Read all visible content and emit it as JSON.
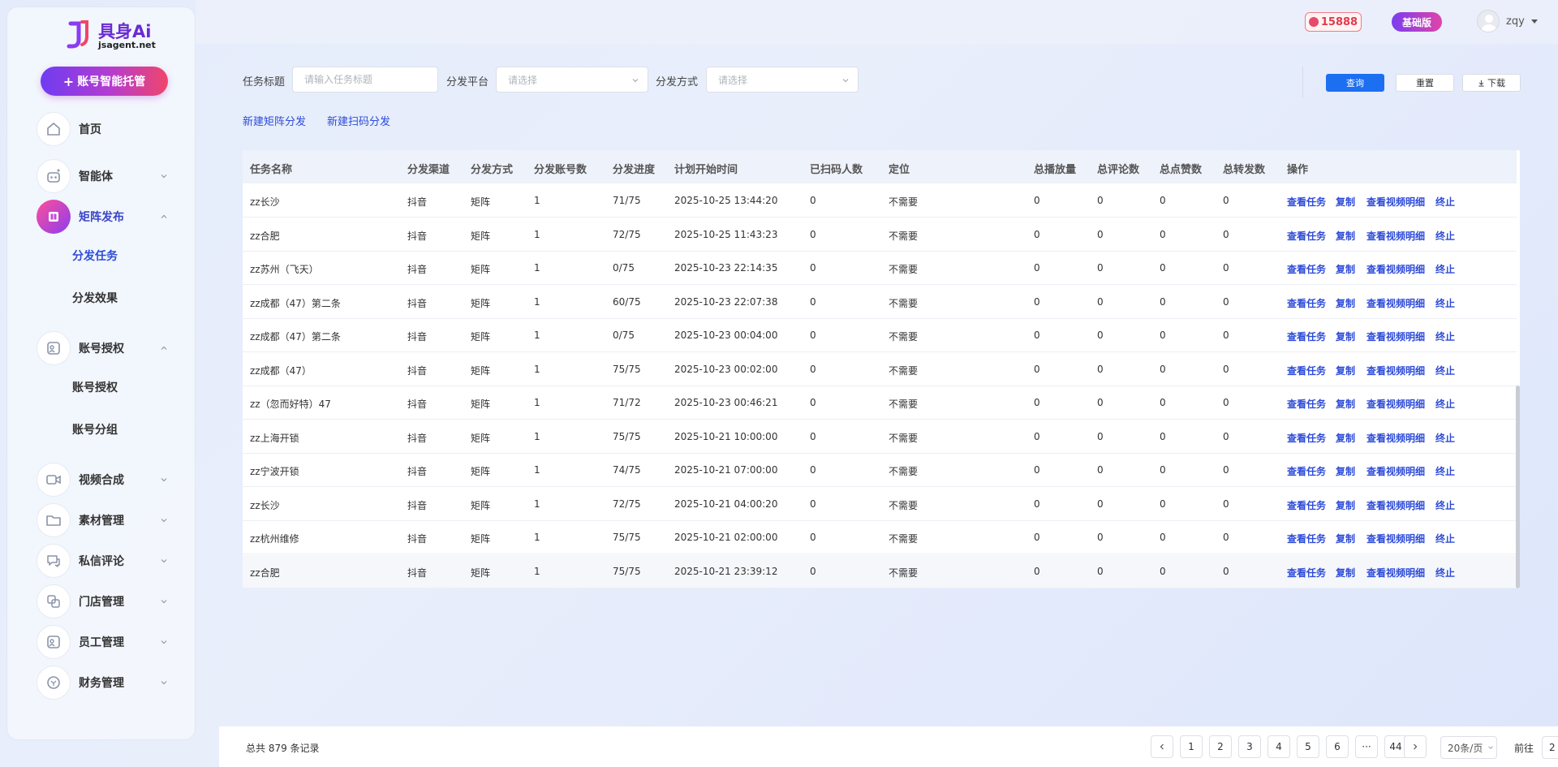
{
  "brand": {
    "title": "具身Ai",
    "subtitle": "jsagent.net"
  },
  "cta": {
    "label": "账号智能托管"
  },
  "nav": {
    "home": "首页",
    "agent": "智能体",
    "matrix": "矩阵发布",
    "matrix_sub": [
      "分发任务",
      "分发效果"
    ],
    "auth": "账号授权",
    "auth_sub": [
      "账号授权",
      "账号分组"
    ],
    "video": "视频合成",
    "material": "素材管理",
    "dm": "私信评论",
    "store": "门店管理",
    "staff": "员工管理",
    "finance": "财务管理"
  },
  "topbar": {
    "points": "15888",
    "plan": "基础版",
    "username": "zqy"
  },
  "filters": {
    "title_label": "任务标题",
    "title_placeholder": "请输入任务标题",
    "platform_label": "分发平台",
    "platform_placeholder": "请选择",
    "method_label": "分发方式",
    "method_placeholder": "请选择",
    "query": "查询",
    "reset": "重置",
    "download": "下载"
  },
  "links": {
    "new_matrix": "新建矩阵分发",
    "new_scan": "新建扫码分发"
  },
  "table": {
    "headers": [
      "任务名称",
      "分发渠道",
      "分发方式",
      "分发账号数",
      "分发进度",
      "计划开始时间",
      "已扫码人数",
      "定位",
      "总播放量",
      "总评论数",
      "总点赞数",
      "总转发数",
      "操作"
    ],
    "actions": [
      "查看任务",
      "复制",
      "查看视频明细",
      "终止"
    ],
    "rows": [
      [
        "zz长沙",
        "抖音",
        "矩阵",
        "1",
        "71/75",
        "2025-10-25 13:44:20",
        "0",
        "不需要",
        "0",
        "0",
        "0",
        "0"
      ],
      [
        "zz合肥",
        "抖音",
        "矩阵",
        "1",
        "72/75",
        "2025-10-25 11:43:23",
        "0",
        "不需要",
        "0",
        "0",
        "0",
        "0"
      ],
      [
        "zz苏州（飞天）",
        "抖音",
        "矩阵",
        "1",
        "0/75",
        "2025-10-23 22:14:35",
        "0",
        "不需要",
        "0",
        "0",
        "0",
        "0"
      ],
      [
        "zz成都（47）第二条",
        "抖音",
        "矩阵",
        "1",
        "60/75",
        "2025-10-23 22:07:38",
        "0",
        "不需要",
        "0",
        "0",
        "0",
        "0"
      ],
      [
        "zz成都（47）第二条",
        "抖音",
        "矩阵",
        "1",
        "0/75",
        "2025-10-23 00:04:00",
        "0",
        "不需要",
        "0",
        "0",
        "0",
        "0"
      ],
      [
        "zz成都（47）",
        "抖音",
        "矩阵",
        "1",
        "75/75",
        "2025-10-23 00:02:00",
        "0",
        "不需要",
        "0",
        "0",
        "0",
        "0"
      ],
      [
        "zz（忽而好特）47",
        "抖音",
        "矩阵",
        "1",
        "71/72",
        "2025-10-23 00:46:21",
        "0",
        "不需要",
        "0",
        "0",
        "0",
        "0"
      ],
      [
        "zz上海开锁",
        "抖音",
        "矩阵",
        "1",
        "75/75",
        "2025-10-21 10:00:00",
        "0",
        "不需要",
        "0",
        "0",
        "0",
        "0"
      ],
      [
        "zz宁波开锁",
        "抖音",
        "矩阵",
        "1",
        "74/75",
        "2025-10-21 07:00:00",
        "0",
        "不需要",
        "0",
        "0",
        "0",
        "0"
      ],
      [
        "zz长沙",
        "抖音",
        "矩阵",
        "1",
        "72/75",
        "2025-10-21 04:00:20",
        "0",
        "不需要",
        "0",
        "0",
        "0",
        "0"
      ],
      [
        "zz杭州维修",
        "抖音",
        "矩阵",
        "1",
        "75/75",
        "2025-10-21 02:00:00",
        "0",
        "不需要",
        "0",
        "0",
        "0",
        "0"
      ],
      [
        "zz合肥",
        "抖音",
        "矩阵",
        "1",
        "75/75",
        "2025-10-21 23:39:12",
        "0",
        "不需要",
        "0",
        "0",
        "0",
        "0"
      ]
    ]
  },
  "pagination": {
    "total": "总共 879 条记录",
    "pages": [
      "1",
      "2",
      "3",
      "4",
      "5",
      "6",
      "···",
      "44"
    ],
    "page_size": "20条/页",
    "goto_label": "前往",
    "goto_value": "2"
  }
}
